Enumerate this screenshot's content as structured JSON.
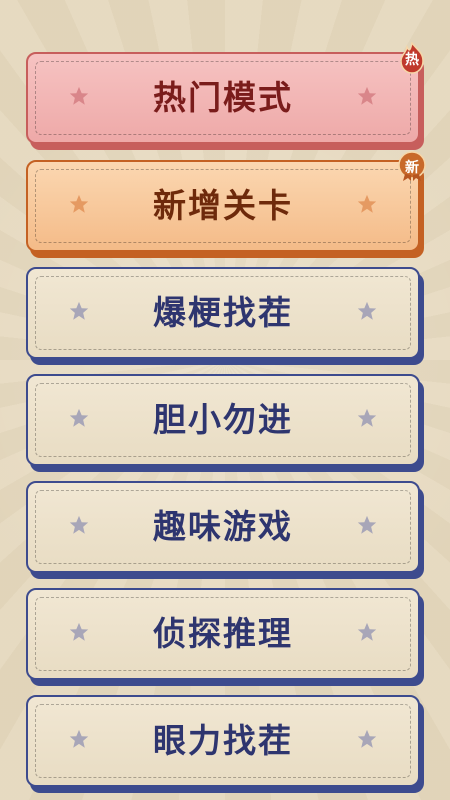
{
  "theme_colors": {
    "background": "#e5d8bd",
    "pink_border": "#c75e5c",
    "orange_border": "#c46123",
    "blue_border": "#3d4b8e",
    "badge_red": "#c0392b",
    "badge_orange": "#c8692a"
  },
  "menu": {
    "items": [
      {
        "label": "热门模式",
        "theme": "pink",
        "badge": "热"
      },
      {
        "label": "新增关卡",
        "theme": "orange",
        "badge": "新"
      },
      {
        "label": "爆梗找茬",
        "theme": "blue"
      },
      {
        "label": "胆小勿进",
        "theme": "blue"
      },
      {
        "label": "趣味游戏",
        "theme": "blue"
      },
      {
        "label": "侦探推理",
        "theme": "blue"
      },
      {
        "label": "眼力找茬",
        "theme": "blue"
      }
    ]
  },
  "icons": {
    "card_decoration": "star-icon",
    "hot_badge": "flame-badge-icon",
    "new_badge": "ribbon-badge-icon"
  }
}
